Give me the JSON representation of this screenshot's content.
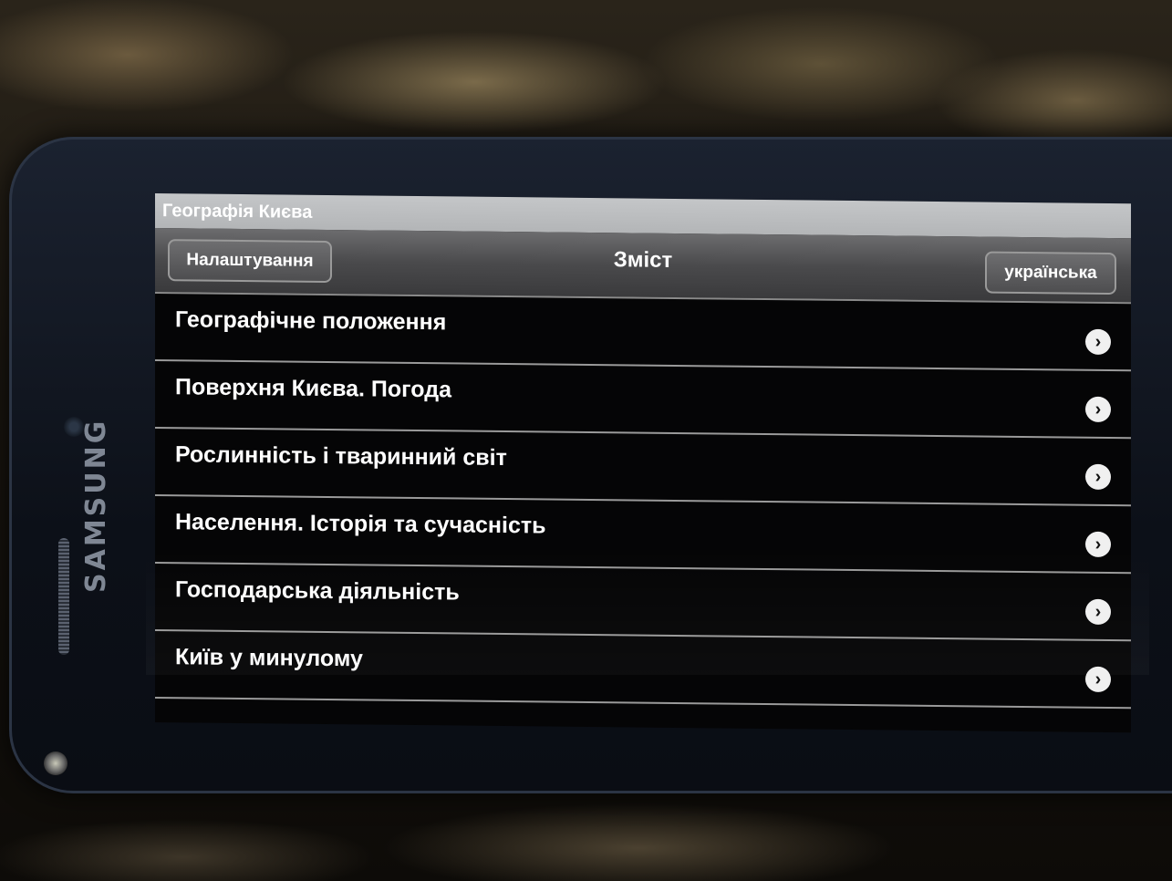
{
  "device": {
    "brand": "SAMSUNG"
  },
  "app": {
    "title": "Географія Києва"
  },
  "nav": {
    "left_button": "Налаштування",
    "title": "Зміст",
    "right_button": "українська"
  },
  "list": {
    "items": [
      {
        "label": "Географічне положення",
        "icon": "chevron-right-icon"
      },
      {
        "label": "Поверхня Києва. Погода",
        "icon": "chevron-right-icon"
      },
      {
        "label": "Рослинність і тваринний світ",
        "icon": "chevron-right-icon"
      },
      {
        "label": "Населення. Історія та сучасність",
        "icon": "chevron-right-icon"
      },
      {
        "label": "Господарська діяльність",
        "icon": "chevron-right-icon"
      },
      {
        "label": "Київ у минулому",
        "icon": "chevron-right-icon"
      }
    ]
  },
  "colors": {
    "title_bar": "#c4c6c8",
    "nav_bar": "#4a4a4c",
    "list_background": "#050506",
    "text": "#ffffff"
  }
}
